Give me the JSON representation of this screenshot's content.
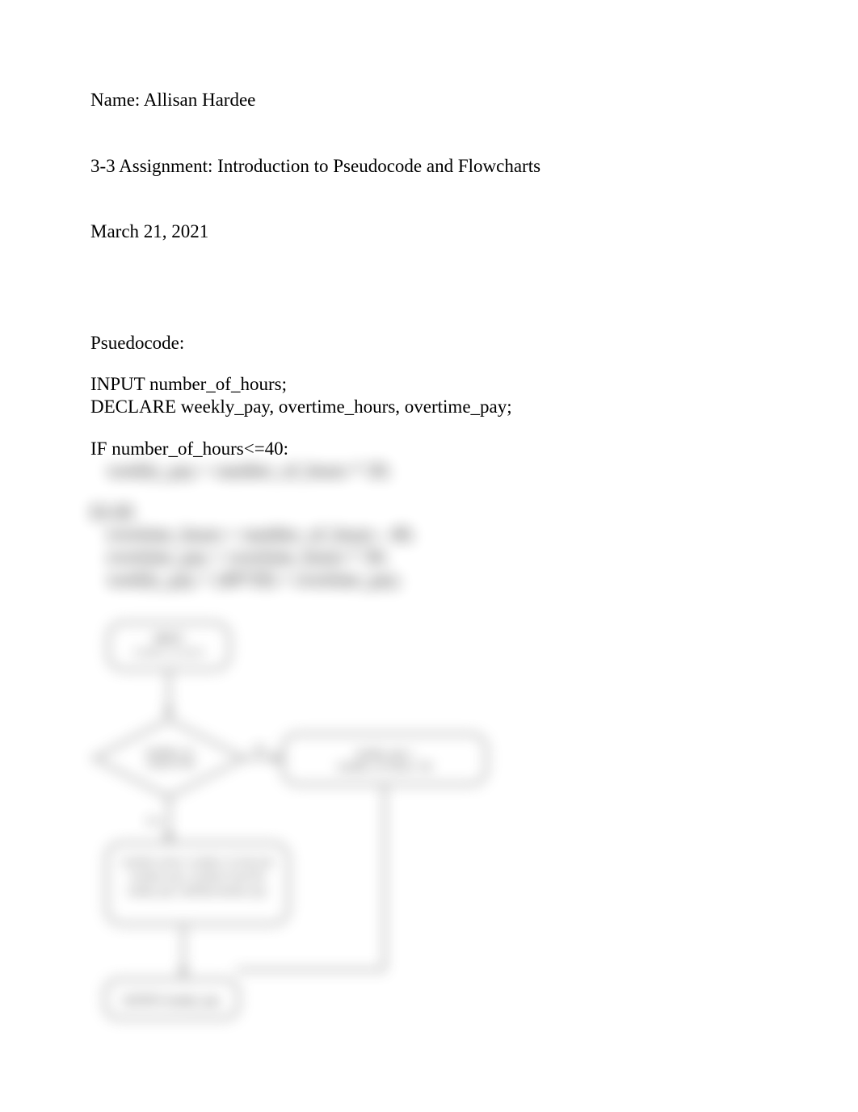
{
  "header": {
    "name_line": "Name: Allisan Hardee",
    "assignment": "3-3 Assignment: Introduction to Pseudocode and Flowcharts",
    "date": "March 21, 2021"
  },
  "pseudocode": {
    "label": "Psuedocode:",
    "line_input": "INPUT number_of_hours;",
    "line_declare": "DECLARE weekly_pay, overtime_hours, overtime_pay;",
    "line_if": "IF number_of_hours<=40:",
    "line_if_body": "weekly_pay = number_of_hours * 20;",
    "line_else": "ELSE",
    "line_else_1": "overtime_hours = number_of_hours - 40;",
    "line_else_2": "overtime_pay = overtime_hours * 30;",
    "line_else_3": "weekly_pay = (40*20) + overtime_pay;"
  },
  "flowchart": {
    "start": "INPUT number_of_hours",
    "decision": "number_of_hours<=40",
    "yes_label": "Yes",
    "no_label": "No",
    "no_process": "weekly_pay = number_of_hours * 20",
    "yes_process": "overtime_hours = number_of_hours - 40; overtime_pay = overtime_hours * 30; weekly_pay = (40*20) + overtime_pay",
    "output": "OUTPUT weekly_pay"
  }
}
